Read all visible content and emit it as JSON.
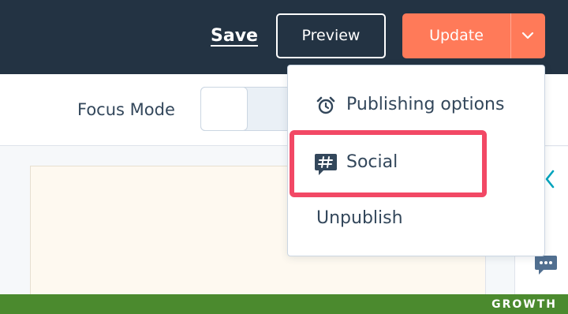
{
  "header": {
    "save_label": "Save",
    "preview_label": "Preview",
    "update_label": "Update"
  },
  "toolbar": {
    "focus_mode_label": "Focus Mode"
  },
  "dropdown": {
    "items": [
      {
        "label": "Publishing options",
        "icon": "alarm-clock-icon"
      },
      {
        "label": "Social",
        "icon": "hashtag-chat-icon",
        "highlighted": true
      },
      {
        "label": "Unpublish"
      }
    ]
  },
  "footer": {
    "brand": "GROWTH"
  },
  "colors": {
    "header_bg": "#233343",
    "update_accent": "#ff7a59",
    "highlight": "#f24865",
    "brand_bar": "#4b8a2e",
    "text_dark": "#33475b",
    "teal": "#00a4bd"
  }
}
